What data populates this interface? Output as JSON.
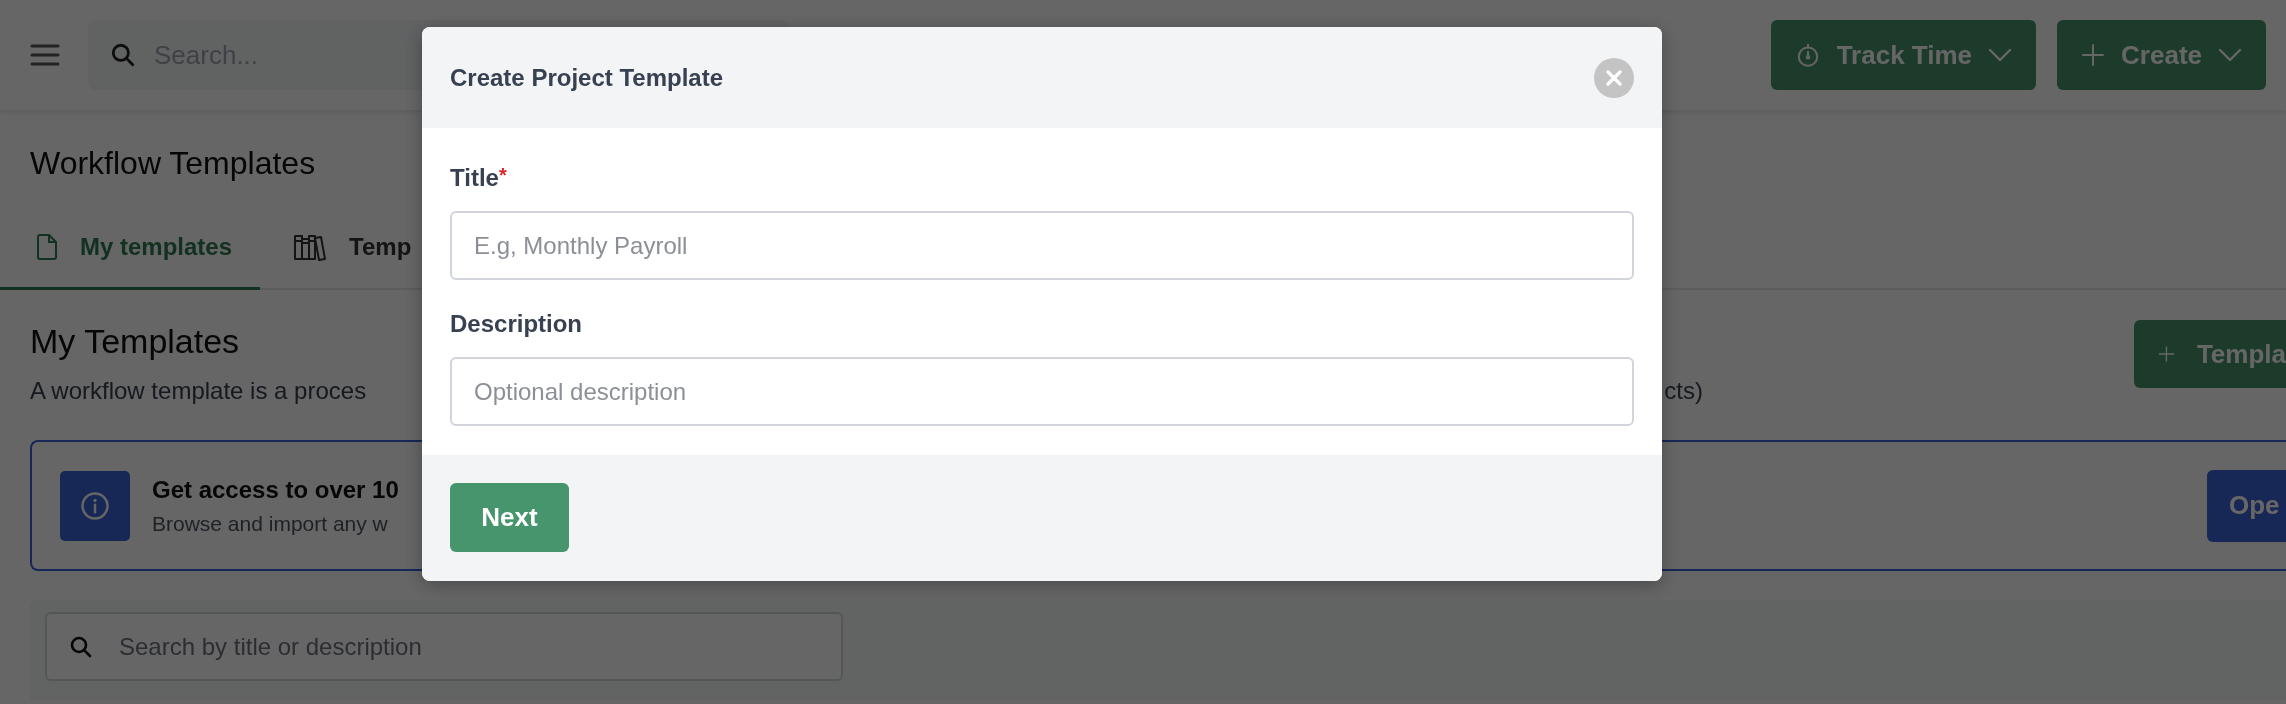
{
  "top_bar": {
    "search_placeholder": "Search...",
    "buttons": [
      {
        "label": "Track Time",
        "kind": "timer"
      },
      {
        "label": "Create",
        "kind": "plus"
      }
    ]
  },
  "page": {
    "title": "Workflow Templates",
    "tabs": [
      {
        "label": "My templates",
        "selected": true,
        "kind": "file"
      },
      {
        "label": "Temp",
        "selected": false,
        "kind": "library"
      }
    ],
    "section": {
      "title": "My Templates",
      "description_parts": [
        "A workflow template is a proces",
        "cts)"
      ],
      "button": "Templa"
    },
    "banner": {
      "title": "Get access to over 10",
      "text": "Browse and import any w",
      "button": "Ope"
    },
    "search": {
      "placeholder": "Search by title or description"
    }
  },
  "modal": {
    "title": "Create Project Template",
    "fields": [
      {
        "label": "Title",
        "required_mark": "*",
        "placeholder": "E.g, Monthly Payroll"
      },
      {
        "label": "Description",
        "placeholder": "Optional description"
      }
    ],
    "button": "Next"
  }
}
